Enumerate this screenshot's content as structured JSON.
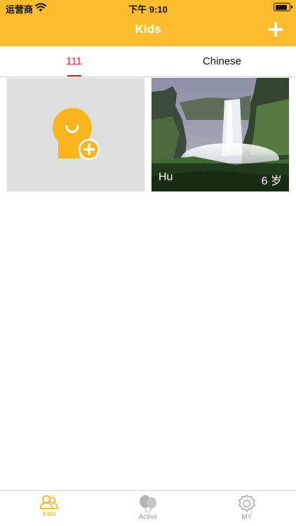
{
  "status_bar": {
    "carrier": "运营商",
    "time": "下午 9:10",
    "battery_level": 0.9
  },
  "nav": {
    "title": "Kids",
    "add_icon": "plus-icon"
  },
  "tabs": [
    {
      "label": "111",
      "active": true
    },
    {
      "label": "Chinese",
      "active": false
    }
  ],
  "kids": [
    {
      "type": "add",
      "icon": "add-kid-icon"
    },
    {
      "type": "kid",
      "name": "Hu",
      "age": "6 岁",
      "photo": "waterfall-photo"
    }
  ],
  "tabbar": [
    {
      "label": "Kids",
      "icon": "kids-icon",
      "active": true
    },
    {
      "label": "Active",
      "icon": "balloons-icon",
      "active": false
    },
    {
      "label": "MY",
      "icon": "gear-icon",
      "active": false
    }
  ],
  "colors": {
    "accent": "#FDBB2E",
    "tab_active": "#E2232A",
    "tabbar_active": "#F5B325",
    "tabbar_inactive": "#9a9a9a"
  }
}
